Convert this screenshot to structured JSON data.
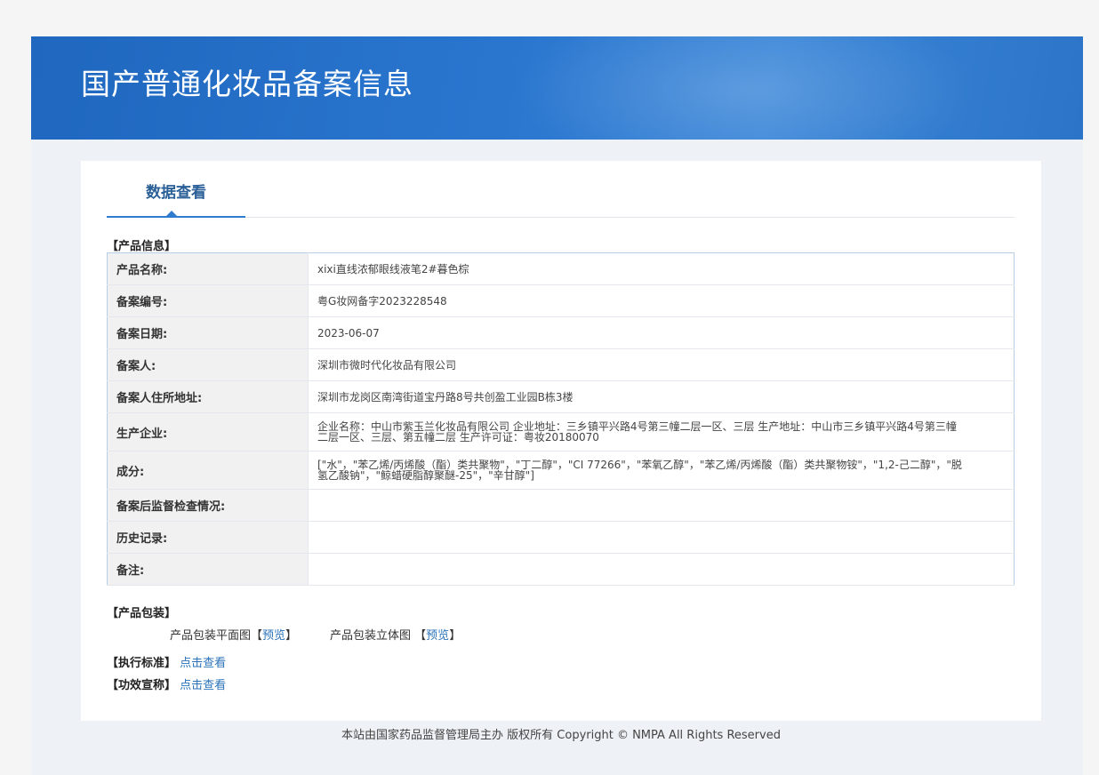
{
  "banner": {
    "title": "国产普通化妆品备案信息"
  },
  "tabs": [
    {
      "label": "数据查看"
    }
  ],
  "product_info": {
    "section_label": "【产品信息】",
    "rows": [
      {
        "label": "产品名称:",
        "value": "xixi直线浓郁眼线液笔2#暮色棕"
      },
      {
        "label": "备案编号:",
        "value": "粤G妆网备字2023228548"
      },
      {
        "label": "备案日期:",
        "value": "2023-06-07"
      },
      {
        "label": "备案人:",
        "value": "深圳市微时代化妆品有限公司"
      },
      {
        "label": "备案人住所地址:",
        "value": "深圳市龙岗区南湾街道宝丹路8号共创盈工业园B栋3楼"
      },
      {
        "label": "生产企业:",
        "value": "企业名称：中山市紫玉兰化妆品有限公司 企业地址：三乡镇平兴路4号第三幢二层一区、三层 生产地址：中山市三乡镇平兴路4号第三幢二层一区、三层、第五幢二层 生产许可证：粤妆20180070"
      },
      {
        "label": "成分:",
        "value": "[\"水\"，\"苯乙烯/丙烯酸（酯）类共聚物\"，\"丁二醇\"，\"CI 77266\"，\"苯氧乙醇\"，\"苯乙烯/丙烯酸（酯）类共聚物铵\"，\"1,2-己二醇\"，\"脱氢乙酸钠\"，\"鲸蜡硬脂醇聚醚-25\"，\"辛甘醇\"]"
      },
      {
        "label": "备案后监督检查情况:",
        "value": ""
      },
      {
        "label": "历史记录:",
        "value": ""
      },
      {
        "label": "备注:",
        "value": ""
      }
    ]
  },
  "packaging": {
    "section_label": "【产品包装】",
    "flat_label": "产品包装平面图",
    "flat_link": "预览",
    "solid_label": "产品包装立体图",
    "solid_link": "预览",
    "bracket_open": "【",
    "bracket_close": "】"
  },
  "standard": {
    "label": "【执行标准】",
    "link": "点击查看"
  },
  "efficacy": {
    "label": "【功效宣称】",
    "link": "点击查看"
  },
  "footer": {
    "text": "本站由国家药品监督管理局主办 版权所有 Copyright © NMPA All Rights Reserved"
  }
}
